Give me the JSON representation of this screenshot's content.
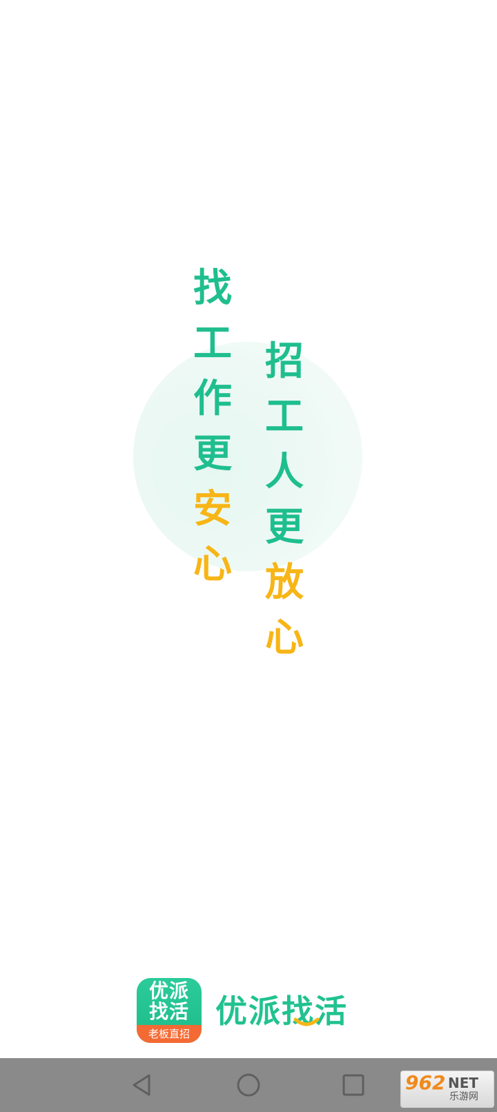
{
  "slogan": {
    "left_column": [
      "找",
      "工",
      "作",
      "更",
      "安",
      "心"
    ],
    "right_column": [
      "招",
      "工",
      "人",
      "更",
      "放",
      "心"
    ]
  },
  "brand": {
    "icon_line1": "优派",
    "icon_line2": "找活",
    "icon_badge": "老板直招",
    "wordmark": "优派找活"
  },
  "watermark": {
    "number": "962",
    "net": "NET",
    "cn": "乐游网"
  },
  "colors": {
    "primary_green": "#1fbe8e",
    "accent_yellow": "#f7b516",
    "badge_orange": "#f46a34",
    "nav_bar_gray": "#8a8a8a"
  },
  "icons": {
    "nav_back": "triangle-back-icon",
    "nav_home": "circle-home-icon",
    "nav_recent": "square-recent-icon"
  }
}
